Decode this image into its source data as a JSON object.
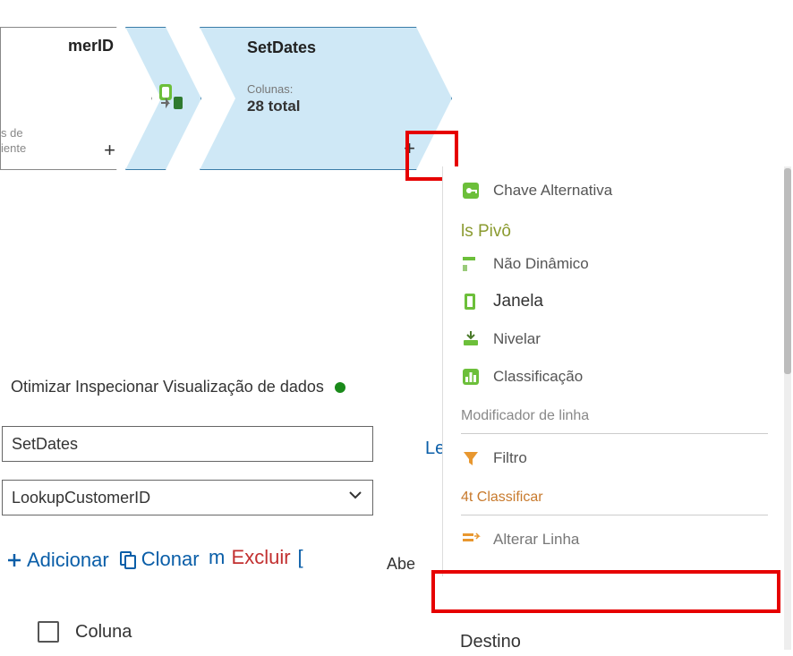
{
  "nodes": {
    "a": {
      "title": "merID",
      "sub_line1": "s de",
      "sub_line2": "iente",
      "plus": "+"
    },
    "b": {
      "title": "SetDates",
      "colunas_label": "Colunas:",
      "colunas_value": "28 total",
      "plus": "+"
    }
  },
  "inspector_bar": "Otimizar Inspecionar Visualização de dados",
  "fields": {
    "output_name": "SetDates",
    "incoming": "LookupCustomerID"
  },
  "actions": {
    "add": "Adicionar",
    "clone": "Clonar",
    "delete": "Excluir"
  },
  "abe": "Abe",
  "letter_l": "Le",
  "column_header": "Coluna",
  "menu": {
    "items": {
      "chave_alt": "Chave Alternativa",
      "nao_dinamico": "Não Dinâmico",
      "janela": "Janela",
      "nivelar": "Nivelar",
      "classificacao": "Classificação",
      "filtro": "Filtro",
      "alterar_linha": "Alterar Linha"
    },
    "groups": {
      "pivo": "ls Pivô",
      "mod_linha": "Modificador de linha",
      "classificar": "4t Classificar",
      "destino": "Destino"
    }
  }
}
